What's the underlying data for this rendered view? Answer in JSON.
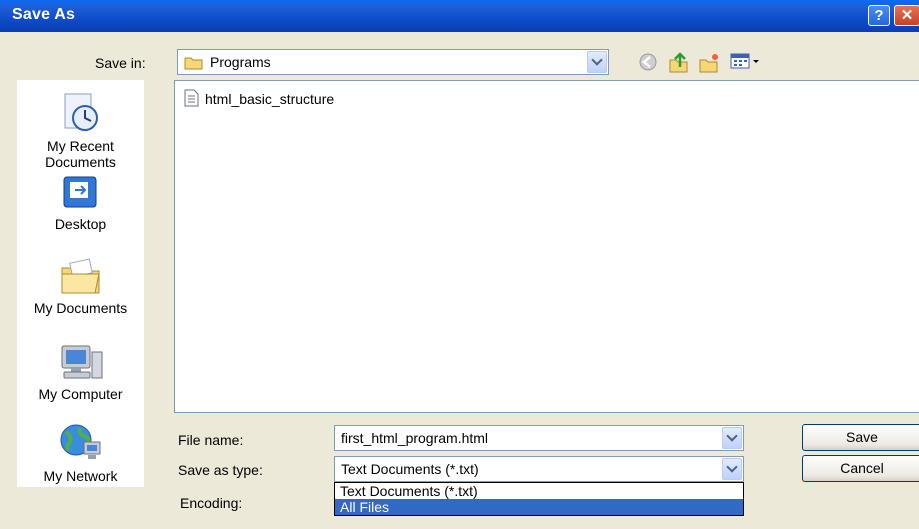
{
  "window": {
    "title": "Save As"
  },
  "titlebar": {
    "help_glyph": "?",
    "close_glyph": "✕"
  },
  "save_in": {
    "label": "Save in:",
    "value": "Programs"
  },
  "toolbar": {
    "icons": [
      "back-icon",
      "up-folder-icon",
      "new-folder-icon",
      "views-menu-icon"
    ]
  },
  "places": [
    {
      "label": "My Recent Documents",
      "icon": "recent-documents-icon"
    },
    {
      "label": "Desktop",
      "icon": "desktop-icon"
    },
    {
      "label": "My Documents",
      "icon": "my-documents-icon"
    },
    {
      "label": "My Computer",
      "icon": "my-computer-icon"
    },
    {
      "label": "My Network",
      "icon": "my-network-icon"
    }
  ],
  "files": [
    {
      "name": "html_basic_structure",
      "icon": "text-file-icon"
    }
  ],
  "file_name": {
    "label": "File name:",
    "value": "first_html_program.html"
  },
  "save_as_type": {
    "label": "Save as type:",
    "value": "Text Documents (*.txt)",
    "options": [
      "Text Documents (*.txt)",
      "All Files"
    ],
    "highlighted": "All Files"
  },
  "encoding": {
    "label": "Encoding:"
  },
  "buttons": {
    "save": "Save",
    "cancel": "Cancel"
  },
  "colors": {
    "title_bar": "#0a52dc",
    "dialog_bg": "#ece9d8",
    "selection": "#316ac5"
  }
}
